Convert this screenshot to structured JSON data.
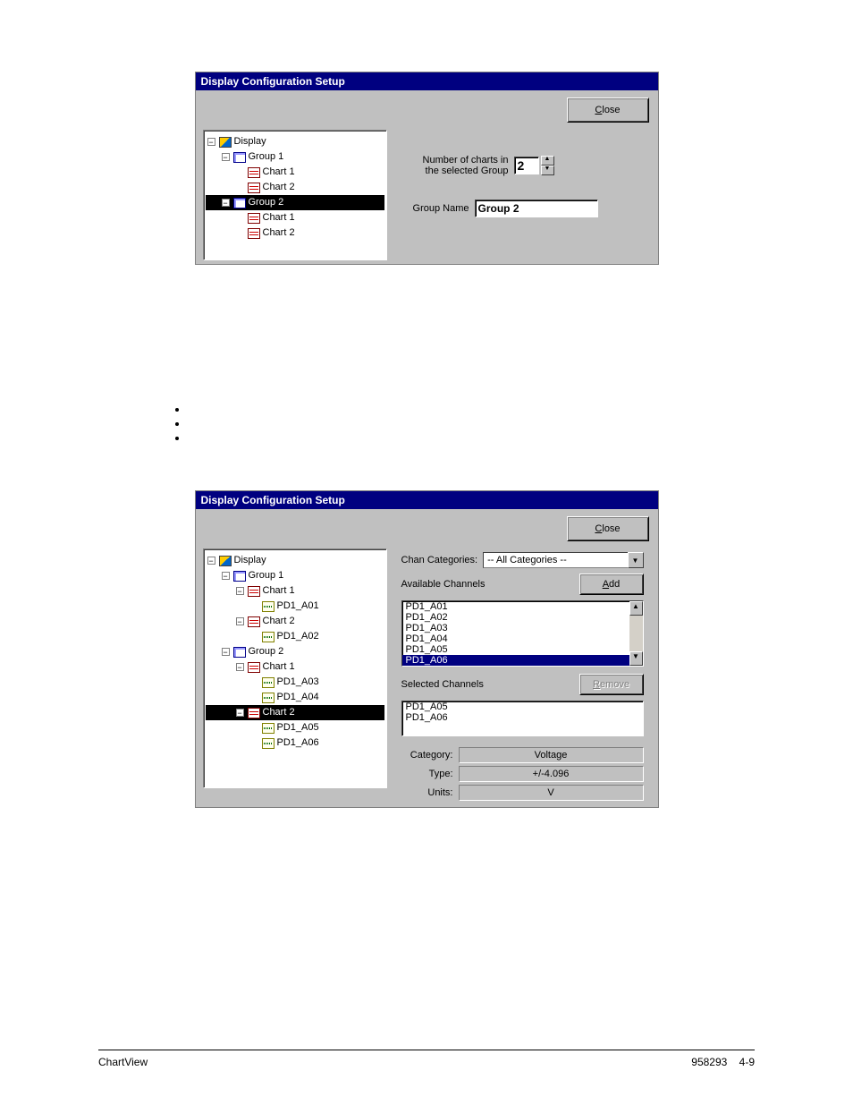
{
  "dialog1": {
    "title": "Display Configuration Setup",
    "close_label": "Close",
    "close_mnemonic": "C",
    "tree": {
      "root": "Display",
      "group1": {
        "name": "Group 1",
        "chart1": "Chart 1",
        "chart2": "Chart 2"
      },
      "group2": {
        "name": "Group 2",
        "chart1": "Chart 1",
        "chart2": "Chart 2"
      }
    },
    "num_charts_label_line1": "Number of charts in",
    "num_charts_label_line2": "the selected Group",
    "num_charts_value": "2",
    "group_name_label": "Group Name",
    "group_name_value": "Group 2"
  },
  "dialog2": {
    "title": "Display Configuration Setup",
    "close_label": "Close",
    "close_mnemonic": "C",
    "tree": {
      "root": "Display",
      "g1": {
        "name": "Group 1",
        "c1": {
          "name": "Chart 1",
          "ch": "PD1_A01"
        },
        "c2": {
          "name": "Chart 2",
          "ch": "PD1_A02"
        }
      },
      "g2": {
        "name": "Group 2",
        "c1": {
          "name": "Chart 1",
          "chA": "PD1_A03",
          "chB": "PD1_A04"
        },
        "c2": {
          "name": "Chart 2",
          "chA": "PD1_A05",
          "chB": "PD1_A06"
        }
      }
    },
    "chan_categories_label": "Chan Categories:",
    "chan_categories_value": "-- All Categories --",
    "add_label": "Add",
    "add_mnemonic": "A",
    "remove_label": "Remove",
    "remove_mnemonic": "R",
    "available_label": "Available Channels",
    "available": [
      "PD1_A01",
      "PD1_A02",
      "PD1_A03",
      "PD1_A04",
      "PD1_A05",
      "PD1_A06"
    ],
    "available_selected_index": 5,
    "selected_label": "Selected Channels",
    "selected": [
      "PD1_A05",
      "PD1_A06"
    ],
    "category_label": "Category:",
    "category_value": "Voltage",
    "type_label": "Type:",
    "type_value": "+/-4.096",
    "units_label": "Units:",
    "units_value": "V"
  },
  "footer": {
    "left": "ChartView",
    "right_page": "4-9",
    "right_docnum": "958293"
  }
}
